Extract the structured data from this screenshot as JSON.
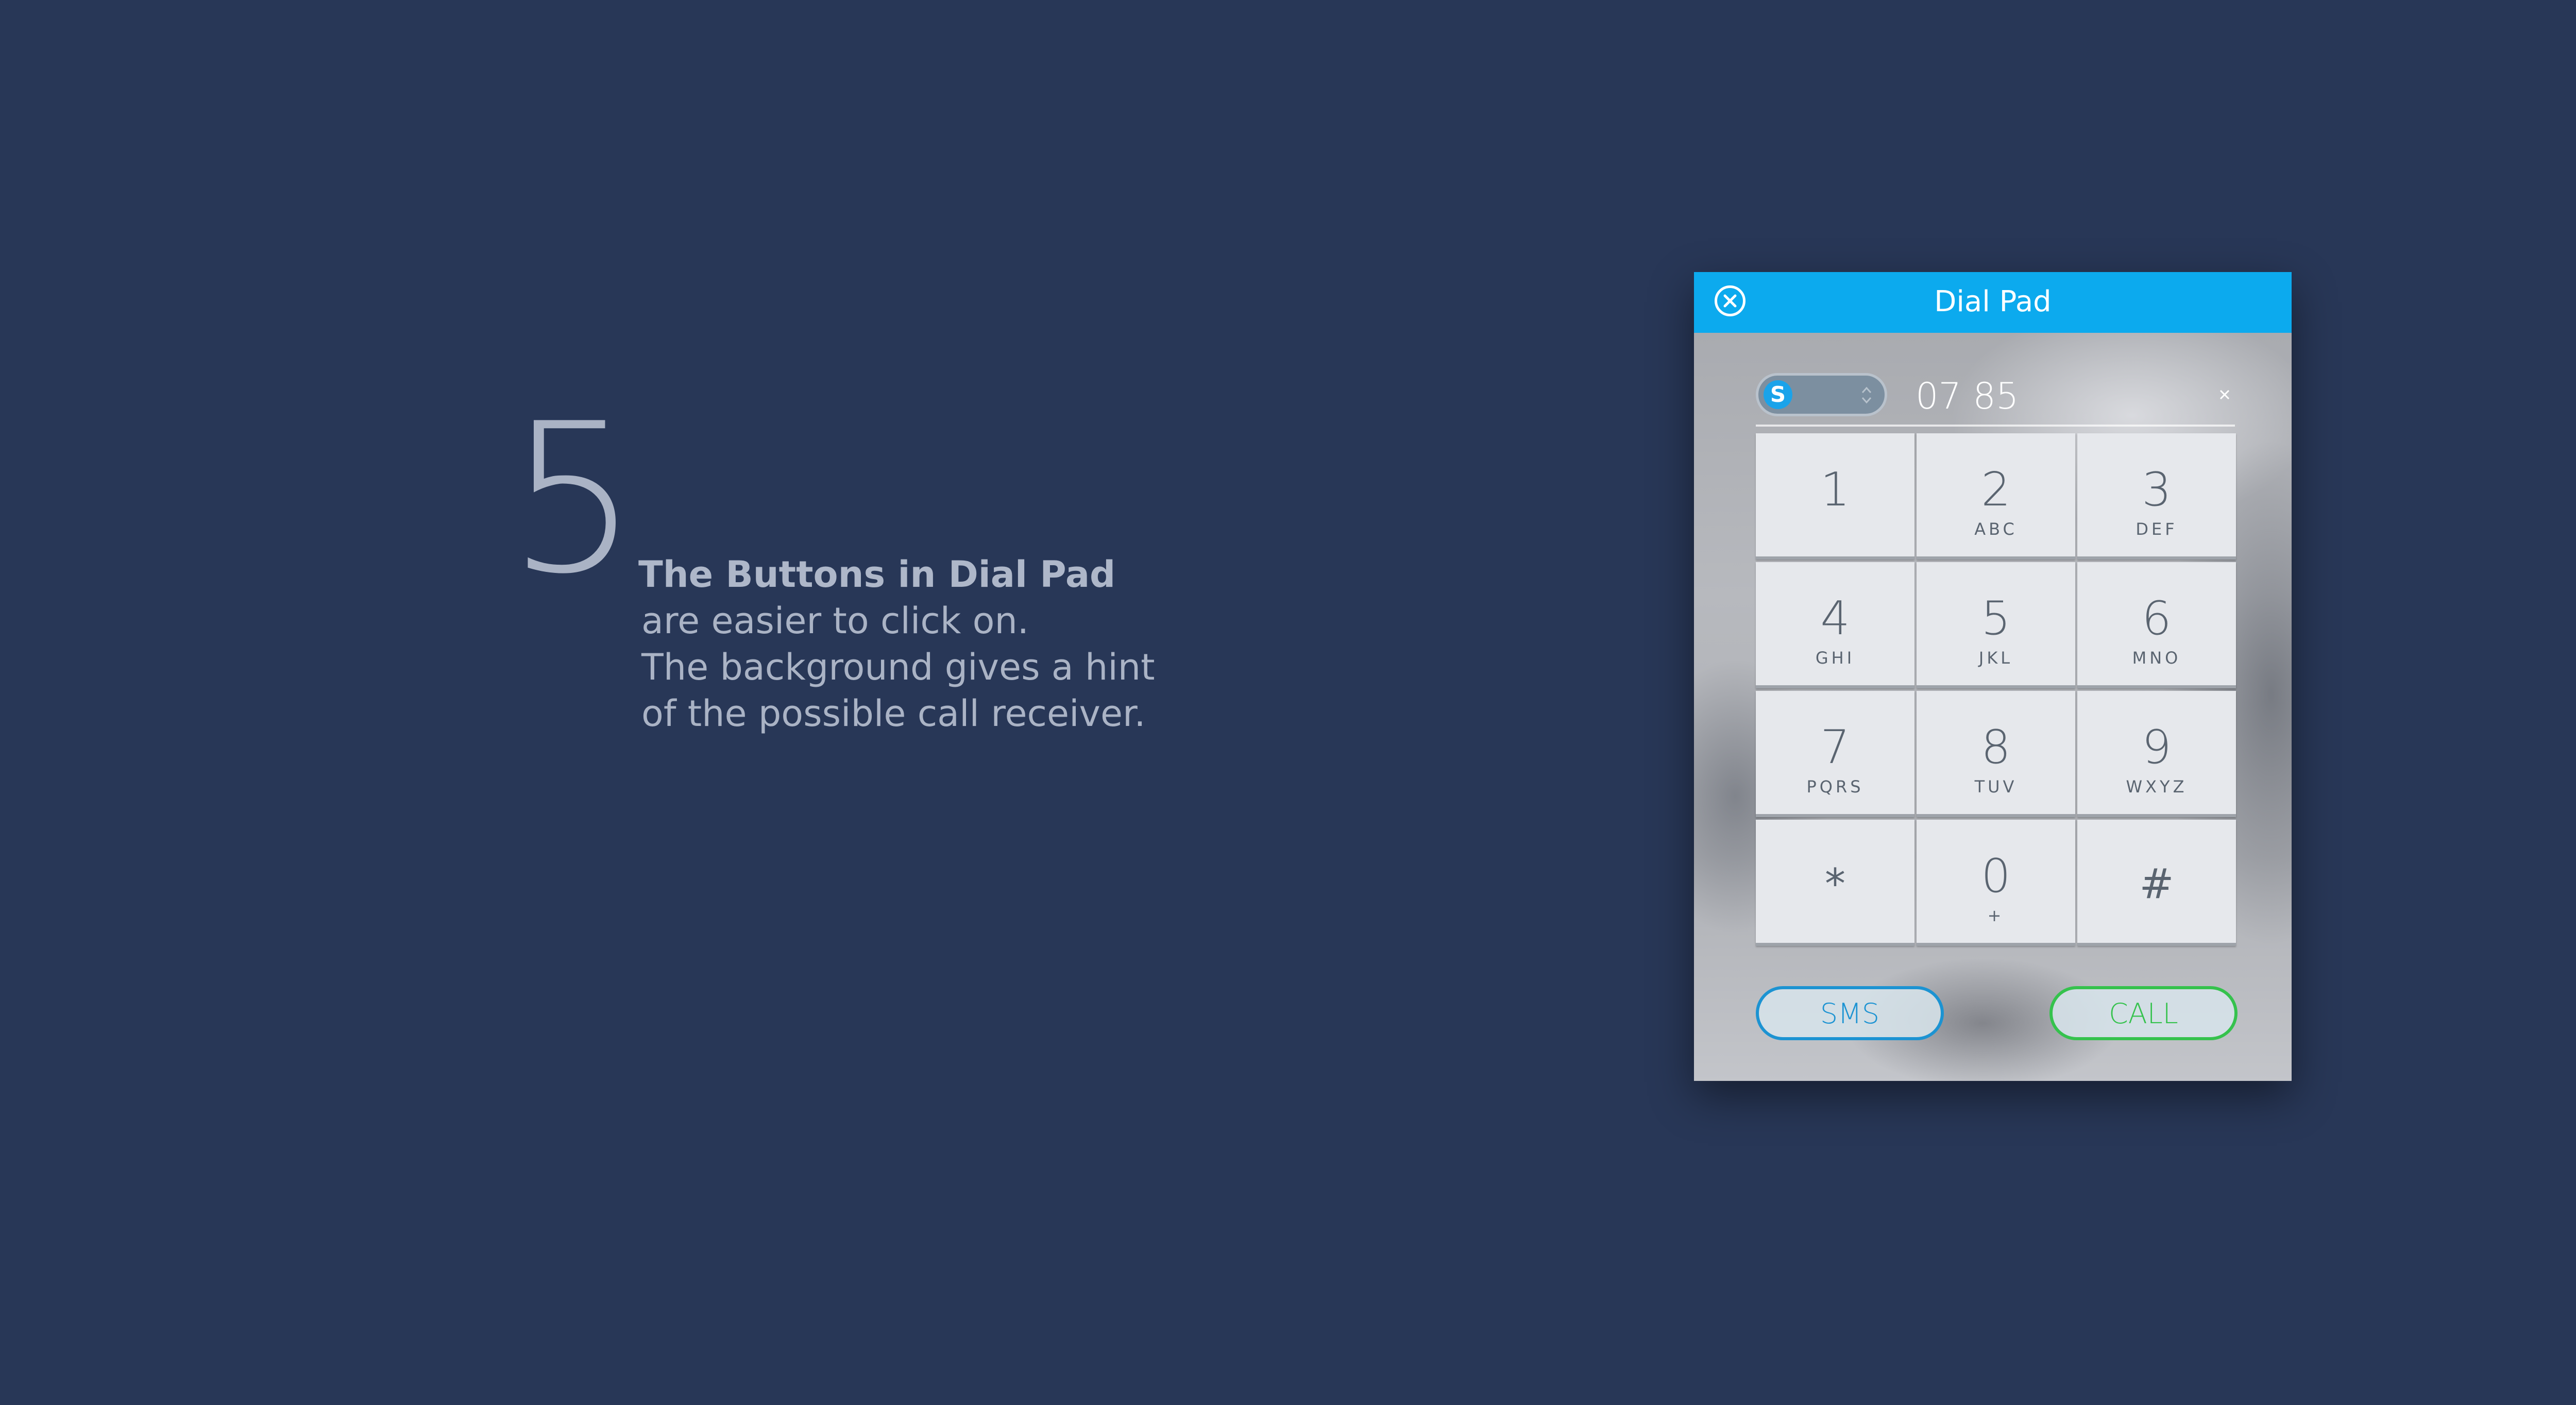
{
  "annotation": {
    "step_number": "5",
    "headline": "The Buttons in Dial Pad",
    "lines": [
      "are easier to click on.",
      "The background gives a hint",
      "of the possible call receiver."
    ]
  },
  "dialpad": {
    "title": "Dial Pad",
    "provider_icon": "S",
    "dialed_number": "07 85",
    "keys": [
      {
        "digit": "1",
        "letters": ""
      },
      {
        "digit": "2",
        "letters": "ABC"
      },
      {
        "digit": "3",
        "letters": "DEF"
      },
      {
        "digit": "4",
        "letters": "GHI"
      },
      {
        "digit": "5",
        "letters": "JKL"
      },
      {
        "digit": "6",
        "letters": "MNO"
      },
      {
        "digit": "7",
        "letters": "PQRS"
      },
      {
        "digit": "8",
        "letters": "TUV"
      },
      {
        "digit": "9",
        "letters": "WXYZ"
      },
      {
        "digit": "*",
        "letters": ""
      },
      {
        "digit": "0",
        "letters": "+"
      },
      {
        "digit": "#",
        "letters": ""
      }
    ],
    "sms_label": "SMS",
    "call_label": "CALL"
  },
  "colors": {
    "page_background": "#283757",
    "titlebar": "#0caaee",
    "sms_accent": "#1c93d2",
    "call_accent": "#35c24d"
  },
  "icons": {
    "close": "close-circle-icon",
    "provider": "skype-icon",
    "stepper": "up-down-chevron-icon",
    "clear": "clear-x-icon"
  }
}
